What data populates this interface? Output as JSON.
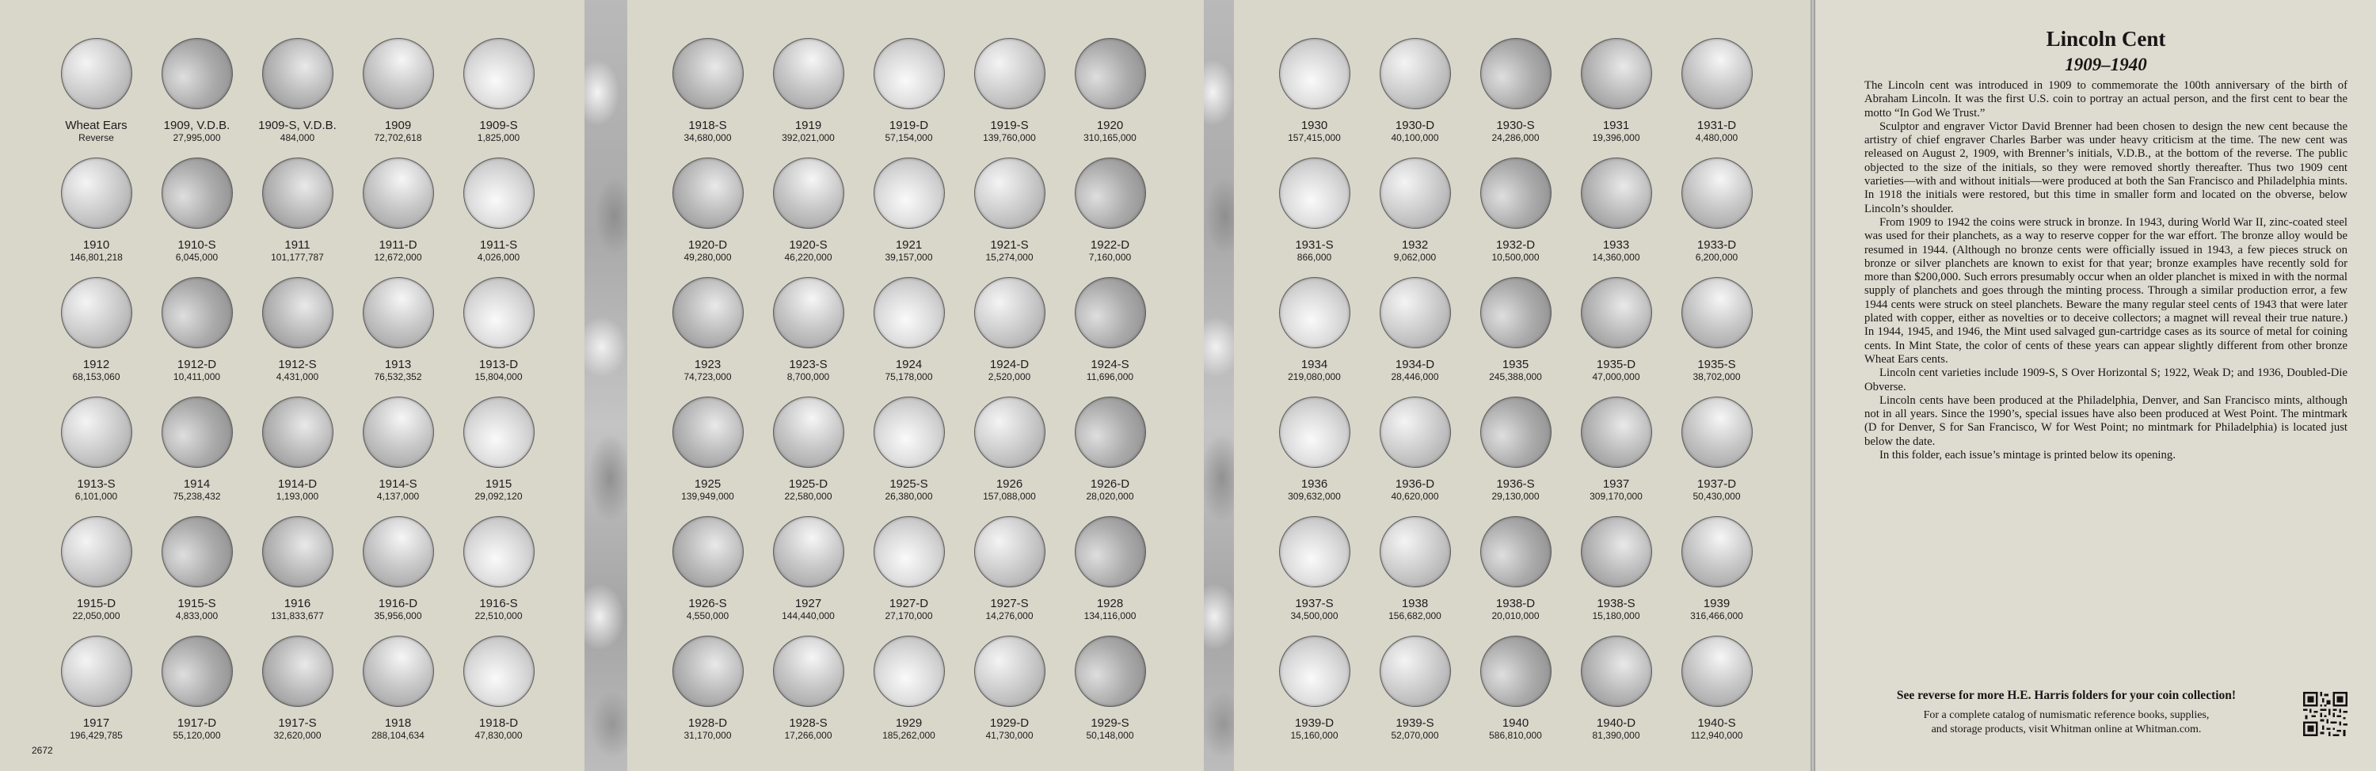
{
  "folder_number": "2672",
  "panels": [
    {
      "slots": [
        {
          "label": "Wheat Ears",
          "mintage": "Reverse"
        },
        {
          "label": "1909, V.D.B.",
          "mintage": "27,995,000"
        },
        {
          "label": "1909-S, V.D.B.",
          "mintage": "484,000"
        },
        {
          "label": "1909",
          "mintage": "72,702,618"
        },
        {
          "label": "1909-S",
          "mintage": "1,825,000"
        },
        {
          "label": "1910",
          "mintage": "146,801,218"
        },
        {
          "label": "1910-S",
          "mintage": "6,045,000"
        },
        {
          "label": "1911",
          "mintage": "101,177,787"
        },
        {
          "label": "1911-D",
          "mintage": "12,672,000"
        },
        {
          "label": "1911-S",
          "mintage": "4,026,000"
        },
        {
          "label": "1912",
          "mintage": "68,153,060"
        },
        {
          "label": "1912-D",
          "mintage": "10,411,000"
        },
        {
          "label": "1912-S",
          "mintage": "4,431,000"
        },
        {
          "label": "1913",
          "mintage": "76,532,352"
        },
        {
          "label": "1913-D",
          "mintage": "15,804,000"
        },
        {
          "label": "1913-S",
          "mintage": "6,101,000"
        },
        {
          "label": "1914",
          "mintage": "75,238,432"
        },
        {
          "label": "1914-D",
          "mintage": "1,193,000"
        },
        {
          "label": "1914-S",
          "mintage": "4,137,000"
        },
        {
          "label": "1915",
          "mintage": "29,092,120"
        },
        {
          "label": "1915-D",
          "mintage": "22,050,000"
        },
        {
          "label": "1915-S",
          "mintage": "4,833,000"
        },
        {
          "label": "1916",
          "mintage": "131,833,677"
        },
        {
          "label": "1916-D",
          "mintage": "35,956,000"
        },
        {
          "label": "1916-S",
          "mintage": "22,510,000"
        },
        {
          "label": "1917",
          "mintage": "196,429,785"
        },
        {
          "label": "1917-D",
          "mintage": "55,120,000"
        },
        {
          "label": "1917-S",
          "mintage": "32,620,000"
        },
        {
          "label": "1918",
          "mintage": "288,104,634"
        },
        {
          "label": "1918-D",
          "mintage": "47,830,000"
        }
      ]
    },
    {
      "slots": [
        {
          "label": "1918-S",
          "mintage": "34,680,000"
        },
        {
          "label": "1919",
          "mintage": "392,021,000"
        },
        {
          "label": "1919-D",
          "mintage": "57,154,000"
        },
        {
          "label": "1919-S",
          "mintage": "139,760,000"
        },
        {
          "label": "1920",
          "mintage": "310,165,000"
        },
        {
          "label": "1920-D",
          "mintage": "49,280,000"
        },
        {
          "label": "1920-S",
          "mintage": "46,220,000"
        },
        {
          "label": "1921",
          "mintage": "39,157,000"
        },
        {
          "label": "1921-S",
          "mintage": "15,274,000"
        },
        {
          "label": "1922-D",
          "mintage": "7,160,000"
        },
        {
          "label": "1923",
          "mintage": "74,723,000"
        },
        {
          "label": "1923-S",
          "mintage": "8,700,000"
        },
        {
          "label": "1924",
          "mintage": "75,178,000"
        },
        {
          "label": "1924-D",
          "mintage": "2,520,000"
        },
        {
          "label": "1924-S",
          "mintage": "11,696,000"
        },
        {
          "label": "1925",
          "mintage": "139,949,000"
        },
        {
          "label": "1925-D",
          "mintage": "22,580,000"
        },
        {
          "label": "1925-S",
          "mintage": "26,380,000"
        },
        {
          "label": "1926",
          "mintage": "157,088,000"
        },
        {
          "label": "1926-D",
          "mintage": "28,020,000"
        },
        {
          "label": "1926-S",
          "mintage": "4,550,000"
        },
        {
          "label": "1927",
          "mintage": "144,440,000"
        },
        {
          "label": "1927-D",
          "mintage": "27,170,000"
        },
        {
          "label": "1927-S",
          "mintage": "14,276,000"
        },
        {
          "label": "1928",
          "mintage": "134,116,000"
        },
        {
          "label": "1928-D",
          "mintage": "31,170,000"
        },
        {
          "label": "1928-S",
          "mintage": "17,266,000"
        },
        {
          "label": "1929",
          "mintage": "185,262,000"
        },
        {
          "label": "1929-D",
          "mintage": "41,730,000"
        },
        {
          "label": "1929-S",
          "mintage": "50,148,000"
        }
      ]
    },
    {
      "slots": [
        {
          "label": "1930",
          "mintage": "157,415,000"
        },
        {
          "label": "1930-D",
          "mintage": "40,100,000"
        },
        {
          "label": "1930-S",
          "mintage": "24,286,000"
        },
        {
          "label": "1931",
          "mintage": "19,396,000"
        },
        {
          "label": "1931-D",
          "mintage": "4,480,000"
        },
        {
          "label": "1931-S",
          "mintage": "866,000"
        },
        {
          "label": "1932",
          "mintage": "9,062,000"
        },
        {
          "label": "1932-D",
          "mintage": "10,500,000"
        },
        {
          "label": "1933",
          "mintage": "14,360,000"
        },
        {
          "label": "1933-D",
          "mintage": "6,200,000"
        },
        {
          "label": "1934",
          "mintage": "219,080,000"
        },
        {
          "label": "1934-D",
          "mintage": "28,446,000"
        },
        {
          "label": "1935",
          "mintage": "245,388,000"
        },
        {
          "label": "1935-D",
          "mintage": "47,000,000"
        },
        {
          "label": "1935-S",
          "mintage": "38,702,000"
        },
        {
          "label": "1936",
          "mintage": "309,632,000"
        },
        {
          "label": "1936-D",
          "mintage": "40,620,000"
        },
        {
          "label": "1936-S",
          "mintage": "29,130,000"
        },
        {
          "label": "1937",
          "mintage": "309,170,000"
        },
        {
          "label": "1937-D",
          "mintage": "50,430,000"
        },
        {
          "label": "1937-S",
          "mintage": "34,500,000"
        },
        {
          "label": "1938",
          "mintage": "156,682,000"
        },
        {
          "label": "1938-D",
          "mintage": "20,010,000"
        },
        {
          "label": "1938-S",
          "mintage": "15,180,000"
        },
        {
          "label": "1939",
          "mintage": "316,466,000"
        },
        {
          "label": "1939-D",
          "mintage": "15,160,000"
        },
        {
          "label": "1939-S",
          "mintage": "52,070,000"
        },
        {
          "label": "1940",
          "mintage": "586,810,000"
        },
        {
          "label": "1940-D",
          "mintage": "81,390,000"
        },
        {
          "label": "1940-S",
          "mintage": "112,940,000"
        }
      ]
    }
  ],
  "info": {
    "title": "Lincoln Cent",
    "subtitle": "1909–1940",
    "paragraphs": [
      "The Lincoln cent was introduced in 1909 to commemorate the 100th anniversary of the birth of Abraham Lincoln. It was the first U.S. coin to portray an actual person, and the first cent to bear the motto “In God We Trust.”",
      "Sculptor and engraver Victor David Brenner had been chosen to design the new cent because the artistry of chief engraver Charles Barber was under heavy criticism at the time. The new cent was released on August 2, 1909, with Brenner’s initials, V.D.B., at the bottom of the reverse. The public objected to the size of the initials, so they were removed shortly thereafter. Thus two 1909 cent varieties—with and without initials—were produced at both the San Francisco and Philadelphia mints. In 1918 the initials were restored, but this time in smaller form and located on the obverse, below Lincoln’s shoulder.",
      "From 1909 to 1942 the coins were struck in bronze. In 1943, during World War II, zinc-coated steel was used for their planchets, as a way to reserve copper for the war effort. The bronze alloy would be resumed in 1944. (Although no bronze cents were officially issued in 1943, a few pieces struck on bronze or silver planchets are known to exist for that year; bronze examples have recently sold for more than $200,000. Such errors presumably occur when an older planchet is mixed in with the normal supply of planchets and goes through the minting process. Through a similar production error, a few 1944 cents were struck on steel planchets. Beware the many regular steel cents of 1943 that were later plated with copper, either as novelties or to deceive collectors; a magnet will reveal their true nature.) In 1944, 1945, and 1946, the Mint used salvaged gun-cartridge cases as its source of metal for coining cents. In Mint State, the color of cents of these years can appear slightly different from other bronze Wheat Ears cents.",
      "Lincoln cent varieties include 1909-S, S Over Horizontal S; 1922, Weak D; and 1936, Doubled-Die Obverse.",
      "Lincoln cents have been produced at the Philadelphia, Denver, and San Francisco mints, although not in all years. Since the 1990’s, special issues have also been produced at West Point. The mintmark (D for Denver, S for San Francisco, W for West Point; no mintmark for Philadelphia) is located just below the date.",
      "In this folder, each issue’s mintage is printed below its opening."
    ],
    "promo_title": "See reverse for more H.E. Harris folders for your coin collection!",
    "promo_line_1": "For a complete catalog of numismatic reference books, supplies,",
    "promo_line_2": "and storage products, visit Whitman online at Whitman.com."
  },
  "icons": {
    "qr": "qr-code-icon"
  },
  "colors": {
    "board": "#d9d6ca",
    "hinge": "#b5b5b5",
    "text": "#1c1c1c"
  }
}
